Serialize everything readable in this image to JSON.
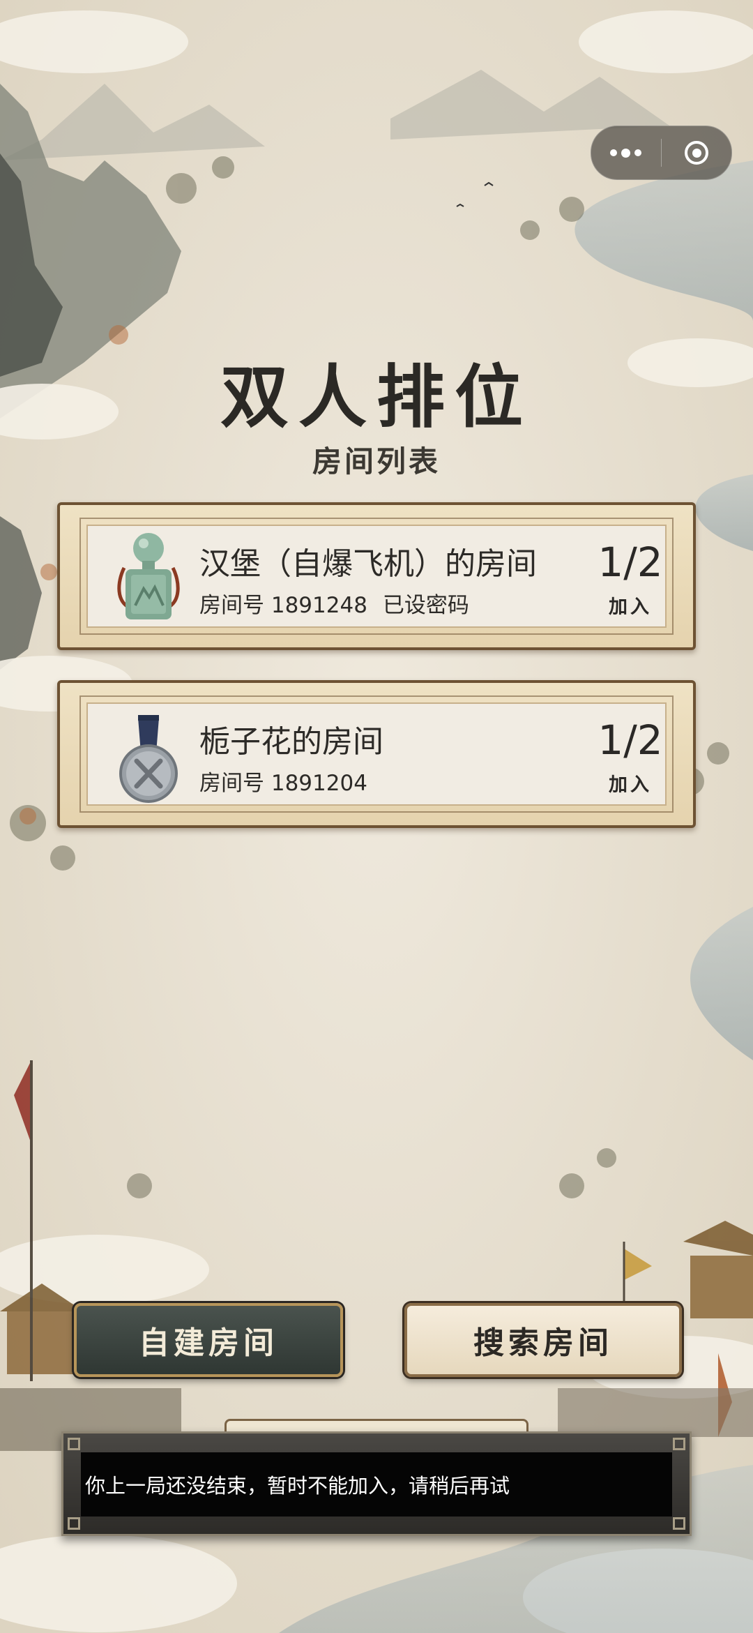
{
  "header": {
    "title": "双人排位",
    "subtitle": "房间列表"
  },
  "capsule": {
    "more_icon": "more-dots-icon",
    "close_icon": "record-target-icon"
  },
  "rooms": [
    {
      "name": "汉堡（自爆飞机）的房间",
      "room_number": "房间号 1891248",
      "password_status": "已设密码",
      "count": "1/2",
      "join_label": "加入",
      "icon": "jade-seal-icon"
    },
    {
      "name": "栀子花的房间",
      "room_number": "房间号 1891204",
      "count": "1/2",
      "join_label": "加入",
      "icon": "silver-medal-icon"
    }
  ],
  "buttons": {
    "create_room": "自建房间",
    "search_room": "搜索房间"
  },
  "toast": {
    "message": "你上一局还没结束，暂时不能加入，请稍后再试"
  },
  "colors": {
    "parchment": "#ece5d6",
    "ink": "#2b2925",
    "create_button": "#3a423e",
    "frame_wood": "#6d5233"
  }
}
